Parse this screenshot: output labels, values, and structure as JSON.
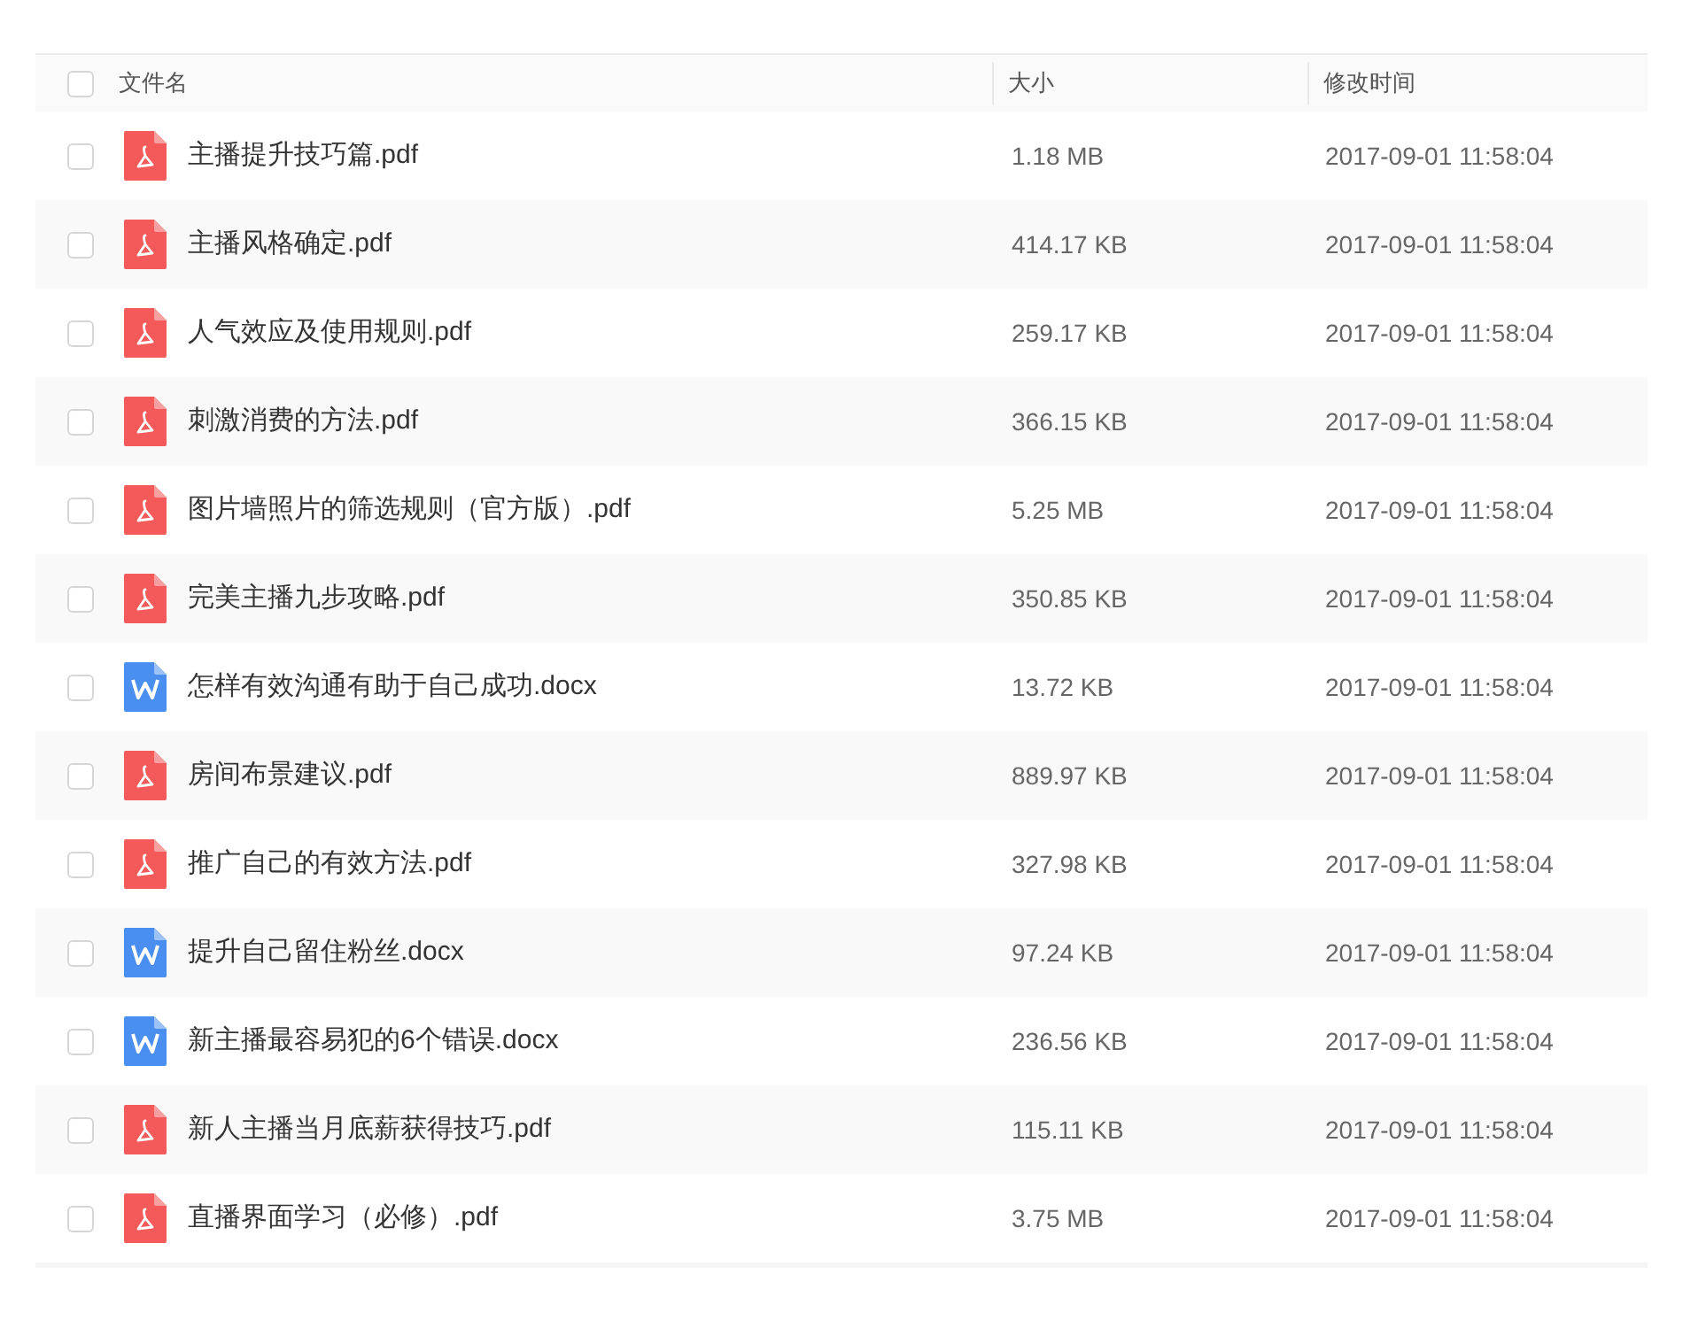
{
  "table": {
    "header": {
      "checked": false,
      "columns": [
        "文件名",
        "大小",
        "修改时间"
      ]
    },
    "rows": [
      {
        "kind": "pdf",
        "checked": false,
        "name": "主播提升技巧篇.pdf",
        "size": "1.18 MB",
        "modified": "2017-09-01 11:58:04"
      },
      {
        "kind": "pdf",
        "checked": false,
        "name": "主播风格确定.pdf",
        "size": "414.17 KB",
        "modified": "2017-09-01 11:58:04"
      },
      {
        "kind": "pdf",
        "checked": false,
        "name": "人气效应及使用规则.pdf",
        "size": "259.17 KB",
        "modified": "2017-09-01 11:58:04"
      },
      {
        "kind": "pdf",
        "checked": false,
        "name": "刺激消费的方法.pdf",
        "size": "366.15 KB",
        "modified": "2017-09-01 11:58:04"
      },
      {
        "kind": "pdf",
        "checked": false,
        "name": "图片墙照片的筛选规则（官方版）.pdf",
        "size": "5.25 MB",
        "modified": "2017-09-01 11:58:04"
      },
      {
        "kind": "pdf",
        "checked": false,
        "name": "完美主播九步攻略.pdf",
        "size": "350.85 KB",
        "modified": "2017-09-01 11:58:04"
      },
      {
        "kind": "docx",
        "checked": false,
        "name": "怎样有效沟通有助于自己成功.docx",
        "size": "13.72 KB",
        "modified": "2017-09-01 11:58:04"
      },
      {
        "kind": "pdf",
        "checked": false,
        "name": "房间布景建议.pdf",
        "size": "889.97 KB",
        "modified": "2017-09-01 11:58:04"
      },
      {
        "kind": "pdf",
        "checked": false,
        "name": "推广自己的有效方法.pdf",
        "size": "327.98 KB",
        "modified": "2017-09-01 11:58:04"
      },
      {
        "kind": "docx",
        "checked": false,
        "name": "提升自己留住粉丝.docx",
        "size": "97.24 KB",
        "modified": "2017-09-01 11:58:04"
      },
      {
        "kind": "docx",
        "checked": false,
        "name": "新主播最容易犯的6个错误.docx",
        "size": "236.56 KB",
        "modified": "2017-09-01 11:58:04"
      },
      {
        "kind": "pdf",
        "checked": false,
        "name": "新人主播当月底薪获得技巧.pdf",
        "size": "115.11 KB",
        "modified": "2017-09-01 11:58:04"
      },
      {
        "kind": "pdf",
        "checked": false,
        "name": "直播界面学习（必修）.pdf",
        "size": "3.75 MB",
        "modified": "2017-09-01 11:58:04"
      }
    ]
  }
}
